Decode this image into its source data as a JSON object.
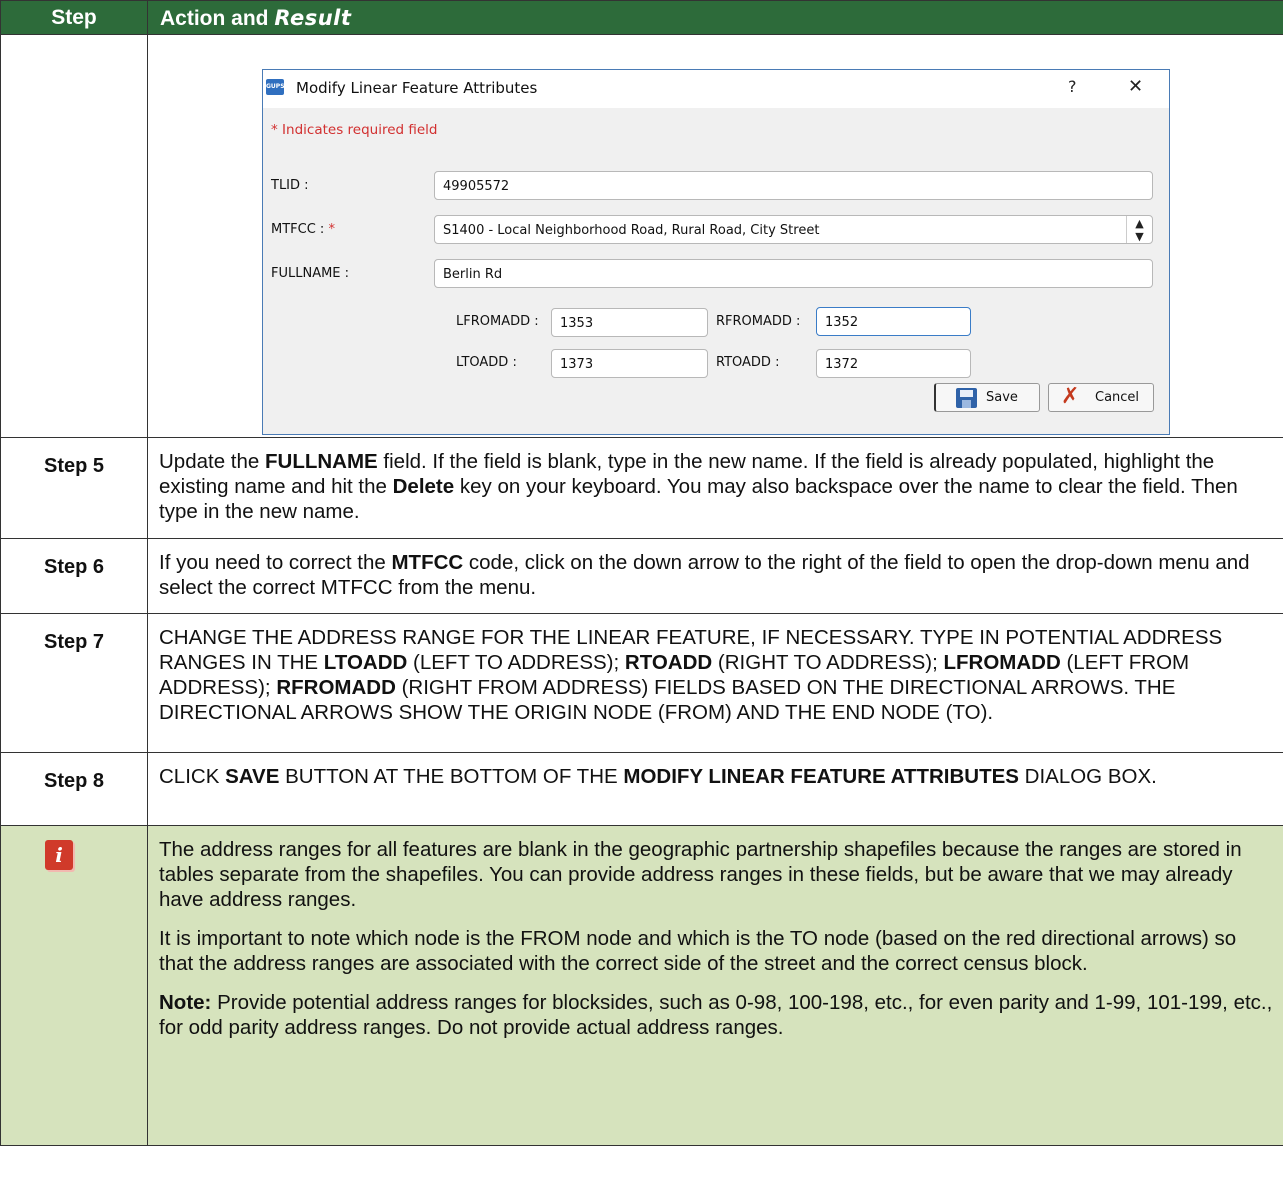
{
  "header": {
    "step": "Step",
    "action_prefix": "Action and",
    "action_result": "Result"
  },
  "dialog": {
    "app_icon_text": "GUPS",
    "title": "Modify Linear Feature Attributes",
    "help": "?",
    "close": "✕",
    "required_note": "* Indicates required field",
    "tlid_label": "TLID :",
    "tlid_value": "49905572",
    "mtfcc_label": "MTFCC : ",
    "mtfcc_star": "*",
    "mtfcc_value": "S1400 - Local Neighborhood Road, Rural Road, City Street",
    "fullname_label": "FULLNAME :",
    "fullname_value": "Berlin Rd",
    "lfromadd_label": "LFROMADD :",
    "lfromadd_value": "1353",
    "rfromadd_label": "RFROMADD :",
    "rfromadd_value": "1352",
    "ltoadd_label": "LTOADD :",
    "ltoadd_value": "1373",
    "rtoadd_label": "RTOADD :",
    "rtoadd_value": "1372",
    "save_label": "Save",
    "cancel_label": "Cancel"
  },
  "steps": [
    {
      "label": "Step 5",
      "t1": "Update the ",
      "b1": "FULLNAME",
      "t2": " field. If the field is blank, type in the new name. If the field is already populated, highlight the existing name and hit the ",
      "b2": "Delete",
      "t3": " key on your keyboard. You may also backspace over the name to clear the field. Then type in the new name."
    },
    {
      "label": "Step 6",
      "t1": "If you need to correct the ",
      "b1": "MTFCC",
      "t2": " code, click on the down arrow to the right of the field to open the drop-down menu and select the correct MTFCC from the menu."
    },
    {
      "label": "Step 7",
      "t1": "CHANGE THE ADDRESS RANGE FOR THE LINEAR FEATURE, IF NECESSARY. TYPE IN POTENTIAL ADDRESS RANGES IN THE ",
      "b1": "LTOADD",
      "t2": " (LEFT TO ADDRESS); ",
      "b2": "RTOADD",
      "t3": " (RIGHT TO ADDRESS); ",
      "b3": "LFROMADD",
      "t4": " (LEFT FROM ADDRESS); ",
      "b4": "RFROMADD",
      "t5": " (RIGHT FROM ADDRESS) FIELDS BASED ON THE DIRECTIONAL ARROWS. THE DIRECTIONAL ARROWS SHOW THE ORIGIN NODE (FROM) AND THE END NODE (TO)."
    },
    {
      "label": "Step 8",
      "t1": "CLICK ",
      "b1": "SAVE",
      "t2": " BUTTON AT THE BOTTOM OF THE ",
      "b2": "MODIFY LINEAR FEATURE ATTRIBUTES",
      "t3": " DIALOG BOX."
    }
  ],
  "note": {
    "icon_text": "i",
    "p1": "The address ranges for all features are blank in the geographic partnership shapefiles because the ranges are stored in tables separate from the shapefiles. You can provide address ranges in these fields, but be aware that we may already have address ranges.",
    "p2": "It is important to note which node is the FROM node and which is the TO node (based on the red directional arrows) so that the address ranges are associated with the correct side of the street and the correct census block.",
    "p3_bold": "Note:",
    "p3": "  Provide potential address ranges for blocksides, such as 0-98, 100-198, etc., for even parity and 1-99, 101-199, etc., for odd parity address ranges. Do not provide actual address ranges."
  },
  "colors": {
    "header_bg": "#2d6b3a",
    "note_bg": "#d6e3bd",
    "required_red": "#d23030",
    "focus_blue": "#3a7cc7"
  }
}
